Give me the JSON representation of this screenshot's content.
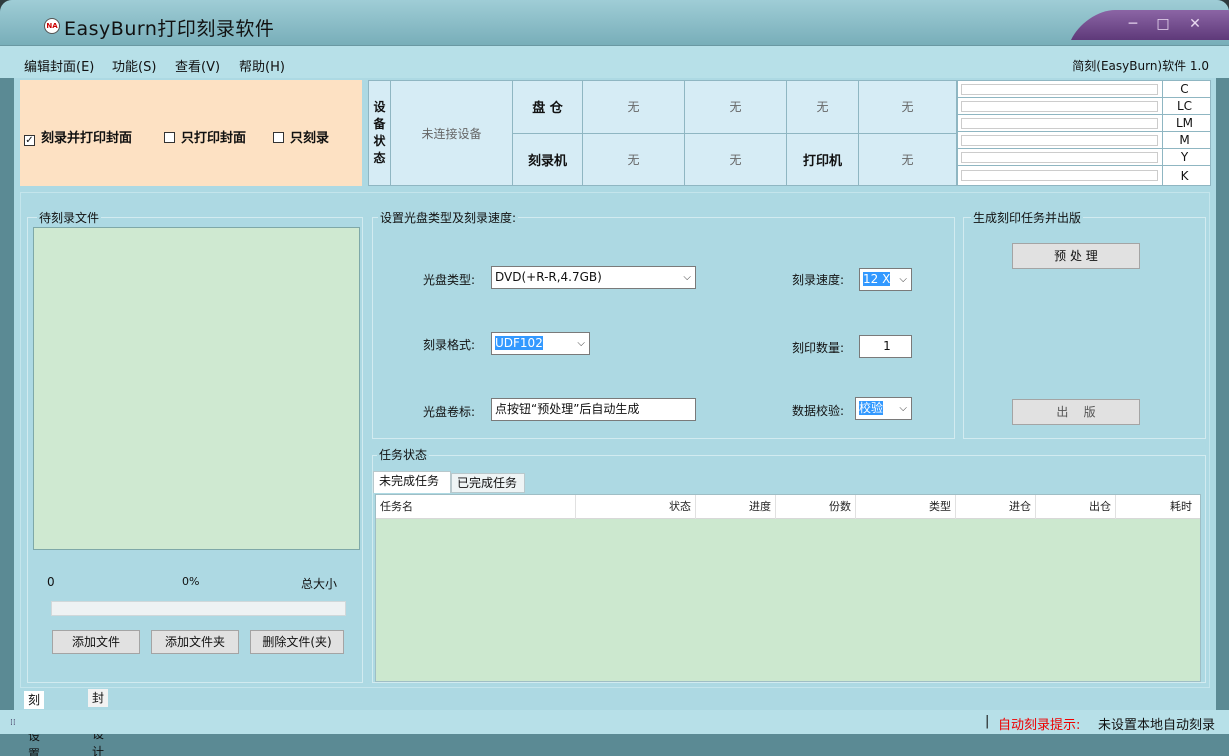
{
  "window": {
    "title": "EasyBurn打印刻录软件",
    "icon": "easyburn-logo-icon",
    "controls": [
      "─",
      "□",
      "✕"
    ]
  },
  "menu": {
    "items": [
      "编辑封面(E)",
      "功能(S)",
      "查看(V)",
      "帮助(H)"
    ],
    "version": "简刻(EasyBurn)软件 1.0"
  },
  "mode": {
    "options": [
      {
        "label": "刻录并打印封面",
        "checked": true
      },
      {
        "label": "只打印封面",
        "checked": false
      },
      {
        "label": "只刻录",
        "checked": false
      }
    ]
  },
  "device_status": {
    "section_label": "设备状态",
    "section_chars": [
      "设",
      "备",
      "状",
      "态"
    ],
    "connection": "未连接设备",
    "disc_bay_label": "盘 仓",
    "disc_bay_values": [
      "无",
      "无",
      "无",
      "无"
    ],
    "burner_label": "刻录机",
    "burner_values": [
      "无",
      "无"
    ],
    "printer_label": "打印机",
    "printer_value": "无"
  },
  "ink": {
    "labels": [
      "C",
      "LC",
      "LM",
      "M",
      "Y",
      "K"
    ]
  },
  "files_panel": {
    "title": "待刻录文件",
    "count": "0",
    "percent": "0%",
    "total_label": "总大小",
    "progress": 0,
    "buttons": [
      "添加文件",
      "添加文件夹",
      "删除文件(夹)"
    ]
  },
  "disc_settings": {
    "title": "设置光盘类型及刻录速度:",
    "disc_type_label": "光盘类型:",
    "disc_type_value": "DVD(+R-R,4.7GB)",
    "format_label": "刻录格式:",
    "format_value": "UDF102",
    "volume_label": "光盘卷标:",
    "volume_value": "点按钮“预处理”后自动生成",
    "speed_label": "刻录速度:",
    "speed_value": "12 X",
    "count_label": "刻印数量:",
    "count_value": "1",
    "verify_label": "数据校验:",
    "verify_value": "校验"
  },
  "job_panel": {
    "title": "生成刻印任务并出版",
    "preprocess": "预 处 理",
    "publish": "出    版"
  },
  "tasks": {
    "title": "任务状态",
    "tabs": [
      "未完成任务",
      "已完成任务"
    ],
    "columns": [
      "任务名",
      "状态",
      "进度",
      "份数",
      "类型",
      "进仓",
      "出仓",
      "耗时"
    ]
  },
  "bottom_tabs": [
    "刻录设置",
    "封面设计"
  ],
  "statusbar": {
    "separator": "|",
    "hint_label": "自动刻录提示:",
    "hint_value": "未设置本地自动刻录"
  }
}
